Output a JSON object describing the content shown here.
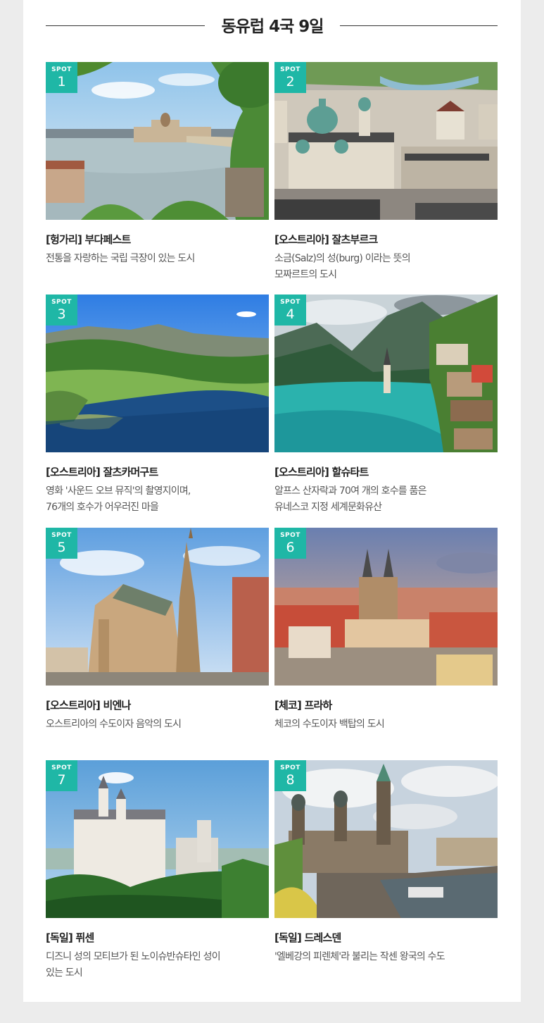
{
  "header": {
    "title": "동유럽 4국 9일"
  },
  "badge_label": "SPOT",
  "spots": [
    {
      "num": "1",
      "title": "[헝가리] 부다페스트",
      "desc": "전통을 자랑하는 국립 극장이 있는 도시"
    },
    {
      "num": "2",
      "title": "[오스트리아] 잘츠부르크",
      "desc": "소금(Salz)의 성(burg) 이라는 뜻의\n모짜르트의 도시"
    },
    {
      "num": "3",
      "title": "[오스트리아] 잘츠카머구트",
      "desc": "영화 '사운드 오브 뮤직'의 촬영지이며,\n76개의 호수가 어우러진 마을"
    },
    {
      "num": "4",
      "title": "[오스트리아] 할슈타트",
      "desc": "알프스 산자락과 70여 개의 호수를 품은\n유네스코 지정 세계문화유산"
    },
    {
      "num": "5",
      "title": "[오스트리아] 비엔나",
      "desc": "오스트리아의 수도이자 음악의 도시"
    },
    {
      "num": "6",
      "title": "[체코] 프라하",
      "desc": "체코의 수도이자 백탑의 도시"
    },
    {
      "num": "7",
      "title": "[독일] 퓌센",
      "desc": "디즈니 성의 모티브가 된 노이슈반슈타인 성이\n있는 도시"
    },
    {
      "num": "8",
      "title": "[독일] 드레스덴",
      "desc": "'엘베강의 피렌체'라 불리는 작센 왕국의 수도"
    }
  ]
}
